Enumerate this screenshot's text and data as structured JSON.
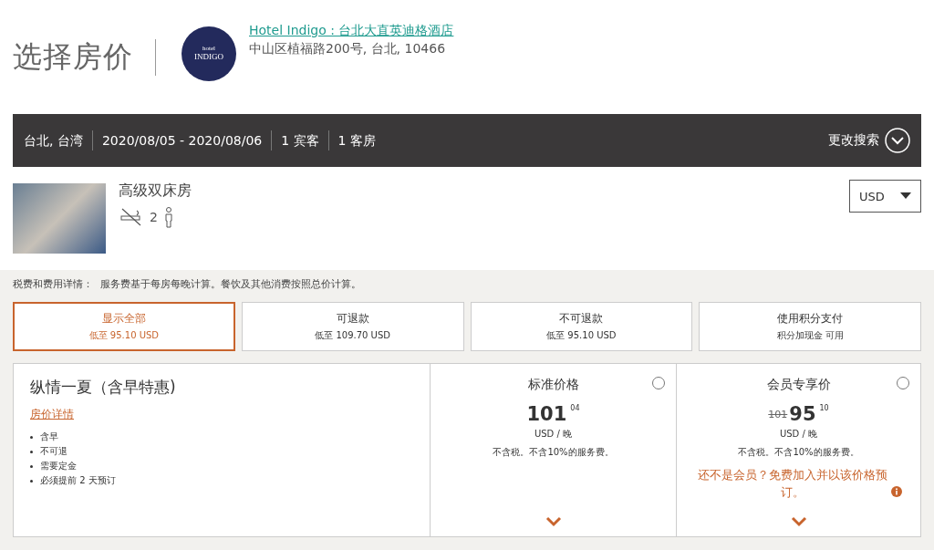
{
  "page_title": "选择房价",
  "hotel": {
    "name": "Hotel Indigo : 台北大直英迪格酒店",
    "address": "中山区植福路200号, 台北, 10466",
    "logo_small": "hotel",
    "logo_big": "INDIGO"
  },
  "search_bar": {
    "items": [
      "台北, 台湾",
      "2020/08/05 - 2020/08/06",
      "1 宾客",
      "1 客房"
    ],
    "change_label": "更改搜索"
  },
  "room": {
    "name": "高级双床房",
    "occupancy": "2",
    "currency": "USD"
  },
  "tax_note": {
    "label": "税费和费用详情：",
    "text": "服务费基于每房每晚计算。餐饮及其他消费按照总价计算。"
  },
  "filters": [
    {
      "title": "显示全部",
      "sub": "低至 95.10 USD",
      "selected": true
    },
    {
      "title": "可退款",
      "sub": "低至 109.70 USD",
      "selected": false
    },
    {
      "title": "不可退款",
      "sub": "低至 95.10 USD",
      "selected": false
    },
    {
      "title": "使用积分支付",
      "sub": "积分加现金 可用",
      "selected": false
    }
  ],
  "rate": {
    "name": "纵情一夏（含早特惠)",
    "details_link": "房价详情",
    "features": [
      "含早",
      "不可退",
      "需要定金",
      "必须提前 2 天预订"
    ]
  },
  "prices": [
    {
      "title": "标准价格",
      "main": "101",
      "cents": "04",
      "unit": "USD / 晚",
      "note": "不含税。不含10%的服务费。",
      "checked": false
    },
    {
      "title": "会员专享价",
      "old": "101",
      "main": "95",
      "cents": "10",
      "unit": "USD / 晚",
      "note": "不含税。不含10%的服务费。",
      "member_note": "还不是会员？免费加入并以该价格预订。",
      "checked": false
    }
  ]
}
